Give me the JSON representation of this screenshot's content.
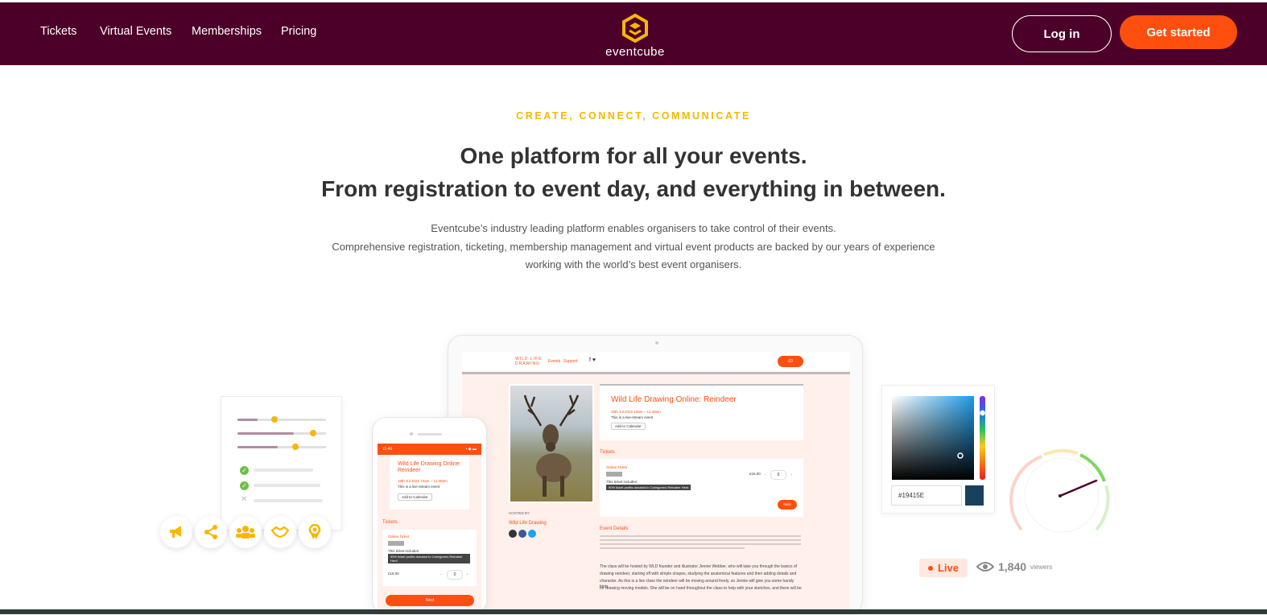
{
  "nav": {
    "links": [
      "Tickets",
      "Virtual Events",
      "Memberships",
      "Pricing"
    ],
    "logo_text": "eventcube",
    "login_label": "Log in",
    "get_started_label": "Get started"
  },
  "hero": {
    "eyebrow": "CREATE, CONNECT, COMMUNICATE",
    "headline_1": "One platform for all your events.",
    "headline_2": "From registration to event day, and everything in between.",
    "para_1": "Eventcube’s industry leading platform enables organisers to take control of their events.",
    "para_2": "Comprehensive registration, ticketing, membership management and virtual event products are backed by our years of experience",
    "para_3": "working with the world’s best event organisers."
  },
  "tablet": {
    "site_logo_1": "WILD LIFE",
    "site_logo_2": "DRAWING",
    "nav_events": "Events",
    "nav_support": "Support",
    "cart": "£0",
    "event_title": "Wild Life Drawing Online: Reindeer",
    "event_date": "16th Jul 2022 10am – 11:30am",
    "event_note": "This is a live-stream event",
    "add_calendar": "Add to Calendar",
    "hosted_by_label": "HOSTED BY",
    "host_name": "Wild Life Drawing",
    "tickets_label": "Tickets",
    "ticket_name": "Online Ticket",
    "ticket_includes": "This ticket includes:",
    "ticket_dark": "90% ticket profits donated to Cairngorms Reindeer Herd",
    "price": "£16.00",
    "qty": "0",
    "next": "Next",
    "event_details_label": "Event Details",
    "body_1": "The class will be hosted by WLD founder and illustrator Jennie Webber, who will take you through the basics of",
    "body_2": "drawing reindeer, starting off with simple shapes, studying the anatomical features and then adding details and",
    "body_3": "character. As this is a live class the reindeer will be moving around freely, so Jennie will give you some handy hints",
    "body_4": "for drawing moving models. She will be on hand throughout the class to help with your sketches, and there will be"
  },
  "phone": {
    "time": "11:49",
    "event_title": "Wild Life Drawing Online: Reindeer",
    "event_date": "16th Jul 2022 10am – 11:30am",
    "event_note": "This is a live-stream event",
    "add_calendar": "Add to Calendar",
    "tickets_label": "Tickets",
    "ticket_name": "Online Ticket",
    "ticket_includes": "This ticket includes:",
    "ticket_dark": "90% ticket profits donated to Cairngorms Reindeer Herd",
    "price": "£16.00",
    "qty": "0",
    "next": "Next"
  },
  "picker": {
    "hex": "#19415E",
    "swatch_color": "#19415e"
  },
  "stats": {
    "live_label": "Live",
    "viewers_count": "1,840",
    "viewers_label": "viewers"
  },
  "colors": {
    "brand_dark": "#4c0029",
    "accent_orange": "#ff4f0f",
    "accent_yellow": "#f8b700"
  },
  "feature_icons": [
    "megaphone-icon",
    "share-icon",
    "users-icon",
    "handshake-icon",
    "award-icon"
  ]
}
